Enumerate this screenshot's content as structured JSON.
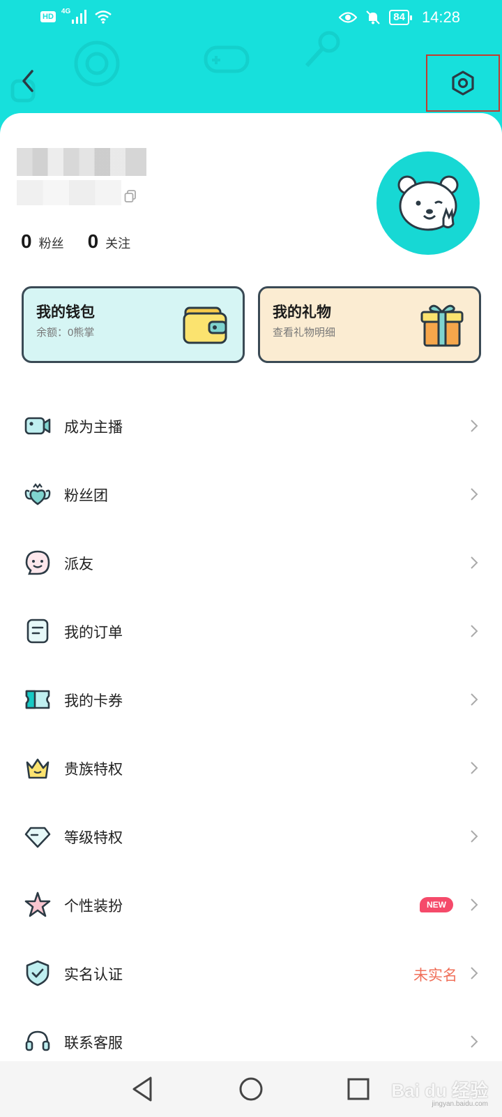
{
  "status_bar": {
    "network_badge": "HD",
    "network_type": "4G",
    "battery": "84",
    "time": "14:28"
  },
  "header": {
    "back_icon": "chevron-left-icon",
    "settings_icon": "settings-icon"
  },
  "profile": {
    "stats": [
      {
        "value": "0",
        "label": "粉丝"
      },
      {
        "value": "0",
        "label": "关注"
      }
    ]
  },
  "cards": {
    "wallet": {
      "title": "我的钱包",
      "subtitle": "余额：0熊掌"
    },
    "gift": {
      "title": "我的礼物",
      "subtitle": "查看礼物明细"
    }
  },
  "menu": {
    "items": [
      {
        "label": "成为主播",
        "icon": "video-camera-icon"
      },
      {
        "label": "粉丝团",
        "icon": "fan-group-icon"
      },
      {
        "label": "派友",
        "icon": "friend-smile-icon"
      },
      {
        "label": "我的订单",
        "icon": "order-icon"
      },
      {
        "label": "我的卡券",
        "icon": "ticket-icon"
      },
      {
        "label": "贵族特权",
        "icon": "crown-icon"
      },
      {
        "label": "等级特权",
        "icon": "diamond-icon"
      },
      {
        "label": "个性装扮",
        "icon": "star-icon",
        "badge": "NEW"
      },
      {
        "label": "实名认证",
        "icon": "shield-check-icon",
        "status": "未实名"
      },
      {
        "label": "联系客服",
        "icon": "headset-icon"
      }
    ]
  },
  "watermark": {
    "text": "Bai du 经验",
    "sub": "jingyan.baidu.com"
  },
  "colors": {
    "accent": "#17e0dc",
    "badge": "#f54a6a",
    "status_text": "#f0705a"
  }
}
